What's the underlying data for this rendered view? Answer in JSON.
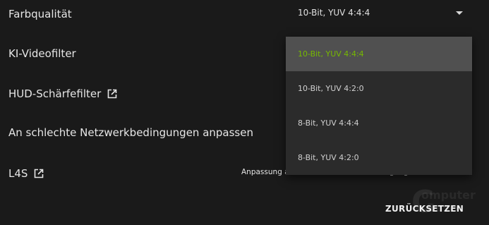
{
  "settings": {
    "color_quality_label": "Farbqualität",
    "video_filter_label": "KI-Videofilter",
    "hud_sharpness_label": "HUD-Schärfefilter",
    "network_adapt_label": "An schlechte Netzwerkbedingungen anpassen",
    "l4s_label": "L4S",
    "network_adapt_hint": "Anpassung an schlechte Netzwerkbedingungen aktivieren"
  },
  "color_quality_select": {
    "selected_value": "10-Bit, YUV 4:4:4",
    "options": [
      "10-Bit, YUV 4:4:4",
      "10-Bit, YUV 4:2:0",
      "8-Bit, YUV 4:4:4",
      "8-Bit, YUV 4:2:0"
    ],
    "selected_index": 0
  },
  "footer": {
    "reset_label": "ZURÜCKSETZEN"
  },
  "watermark": {
    "letter": "C",
    "line1": "omputer",
    "line2": "Base"
  },
  "colors": {
    "background": "#1a1a1a",
    "dropdown_bg": "#2b2b2b",
    "selected_bg": "#505050",
    "accent_green": "#76b900"
  },
  "icons": {
    "external_link": "external-link-icon",
    "dropdown_arrow": "chevron-down-icon"
  }
}
